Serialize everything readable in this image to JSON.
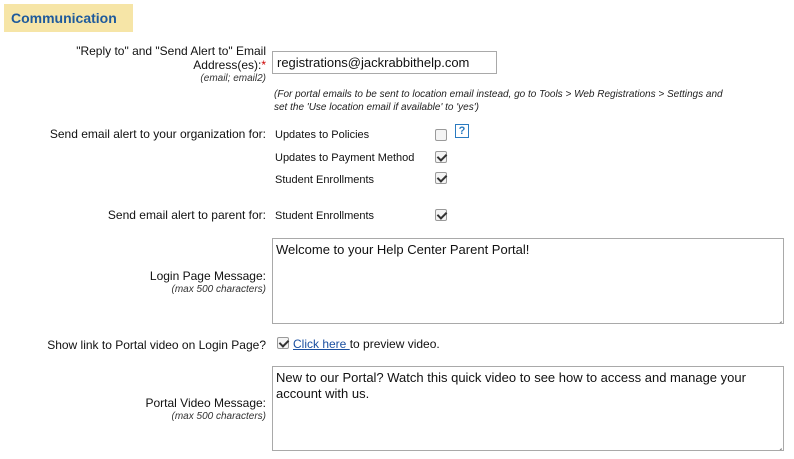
{
  "section": {
    "title": "Communication"
  },
  "reply_to": {
    "label_line1": "\"Reply to\" and \"Send Alert to\" Email",
    "label_line2": "Address(es):",
    "required_mark": "*",
    "hint": "(email; email2)",
    "value": "registrations@jackrabbithelp.com",
    "note_line1": "(For portal emails to be sent to location email instead, go to Tools > Web Registrations > Settings and",
    "note_line2": "set the 'Use location email if available' to 'yes')"
  },
  "org_alerts": {
    "label": "Send email alert to your organization for:",
    "help_icon": "?",
    "options": [
      {
        "label": "Updates to Policies",
        "checked": false
      },
      {
        "label": "Updates to Payment Method",
        "checked": true
      },
      {
        "label": "Student Enrollments",
        "checked": true
      }
    ]
  },
  "parent_alerts": {
    "label": "Send email alert to parent for:",
    "options": [
      {
        "label": "Student Enrollments",
        "checked": true
      }
    ]
  },
  "login_message": {
    "label": "Login Page Message:",
    "hint": "(max 500 characters)",
    "value": "Welcome to your Help Center Parent Portal!"
  },
  "portal_video_link": {
    "label": "Show link to Portal video on Login Page?",
    "checked": true,
    "link_text": "Click here ",
    "suffix_text": "to preview video."
  },
  "portal_video_message": {
    "label": "Portal Video Message:",
    "hint": "(max 500 characters)",
    "value": "New to our Portal? Watch this quick video to see how to access and manage your account with us."
  }
}
